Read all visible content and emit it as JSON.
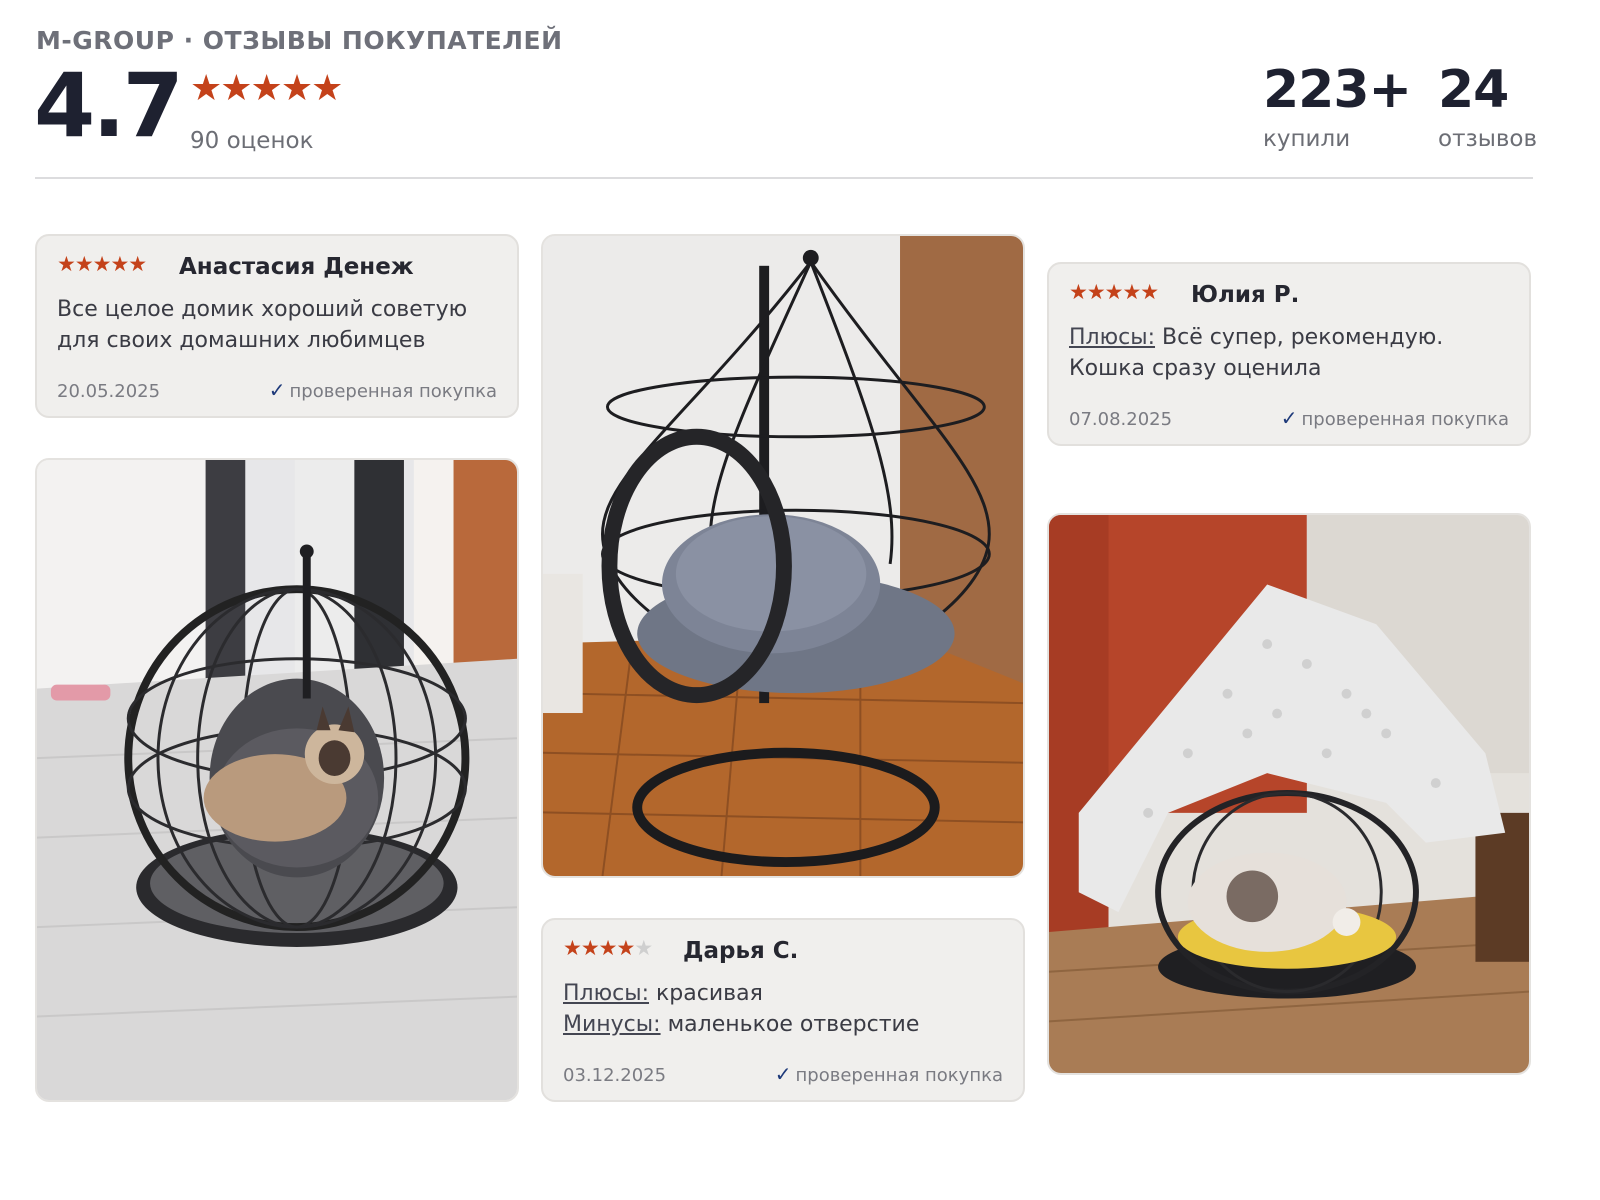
{
  "header": {
    "brand": "M-GROUP · ОТЗЫВЫ ПОКУПАТЕЛЕЙ",
    "rating": "4.7",
    "stars": "★★★★★",
    "ratings_count": "90 оценок",
    "bought_value": "223+",
    "bought_label": "купили",
    "reviews_value": "24",
    "reviews_label": "отзывов"
  },
  "colors": {
    "accent_star": "#c4421a",
    "verified_check": "#1e3a7a",
    "card_bg": "#f0efed"
  },
  "reviews": [
    {
      "stars": "★★★★★",
      "author": "Анастасия Денеж",
      "text": "Все целое домик хороший советую для своих домашних любимцев",
      "date": "20.05.2025",
      "verified": "проверенная покупка"
    },
    {
      "stars_on": "★★★★",
      "stars_off": "★",
      "author": "Дарья С.",
      "pros_label": "Плюсы:",
      "pros": "красивая",
      "cons_label": "Минусы:",
      "cons": "маленькое отверстие",
      "date": "03.12.2025",
      "verified": "проверенная покупка"
    },
    {
      "stars": "★★★★★",
      "author": "Юлия Р.",
      "pros_label": "Плюсы:",
      "pros": "Всё супер, рекомендую. Кошка сразу оценила",
      "date": "07.08.2025",
      "verified": "проверенная покупка"
    }
  ],
  "verified_icon": "checkmark-icon"
}
